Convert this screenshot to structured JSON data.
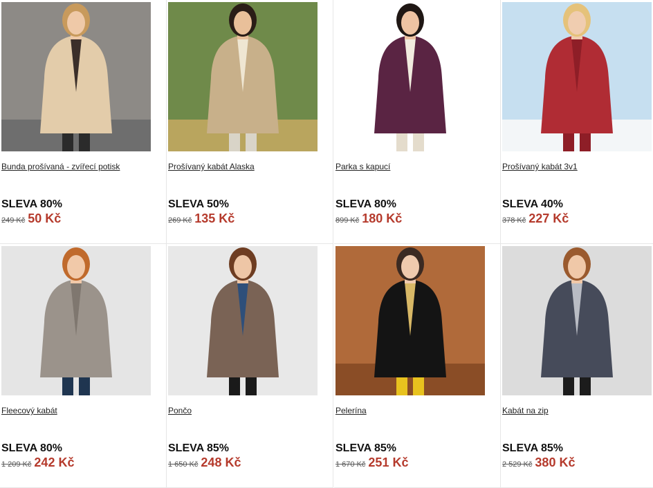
{
  "products": [
    {
      "name": "Bunda prošívaná - zvířecí potisk",
      "discount": "SLEVA 80%",
      "old_price": "249 Kč",
      "new_price": "50 Kč",
      "bg": "#8d8a86",
      "ground": "#6e6e6e",
      "garment": "#e3ccaa",
      "accent": "#3b2f2a",
      "hair": "#c89a5c",
      "skin": "#efc9a8",
      "legs": "#2b2b2b",
      "image": "woman-cream-quilted-jacket"
    },
    {
      "name": "Prošívaný kabát Alaska",
      "discount": "SLEVA 50%",
      "old_price": "269 Kč",
      "new_price": "135 Kč",
      "bg": "#6f8a4a",
      "ground": "#b9a55e",
      "garment": "#c8b08a",
      "accent": "#efe6d2",
      "hair": "#2a1d17",
      "skin": "#e9c09a",
      "legs": "#d9d4c8",
      "image": "woman-beige-quilted-coat"
    },
    {
      "name": "Parka s kapucí",
      "discount": "SLEVA 80%",
      "old_price": "899 Kč",
      "new_price": "180 Kč",
      "bg": "#ffffff",
      "ground": "#ffffff",
      "garment": "#5a2443",
      "accent": "#f1ebdf",
      "hair": "#1f1714",
      "skin": "#eec3a3",
      "legs": "#e4dccc",
      "image": "woman-purple-parka"
    },
    {
      "name": "Prošívaný kabát 3v1",
      "discount": "SLEVA 40%",
      "old_price": "378 Kč",
      "new_price": "227 Kč",
      "bg": "#c6dff0",
      "ground": "#f3f6f8",
      "garment": "#b02c34",
      "accent": "#8e1e27",
      "hair": "#e5c27a",
      "skin": "#f0cdb0",
      "legs": "#8e1e27",
      "image": "woman-red-winter-coat"
    },
    {
      "name": "Fleecový kabát",
      "discount": "SLEVA 80%",
      "old_price": "1 209 Kč",
      "new_price": "242 Kč",
      "bg": "#e5e5e5",
      "ground": "#e5e5e5",
      "garment": "#9b938b",
      "accent": "#7f776f",
      "hair": "#c06a2c",
      "skin": "#f1c9a9",
      "legs": "#1f3550",
      "image": "woman-grey-fleece-coat"
    },
    {
      "name": "Pončo",
      "discount": "SLEVA 85%",
      "old_price": "1 650 Kč",
      "new_price": "248 Kč",
      "bg": "#e8e8e8",
      "ground": "#e8e8e8",
      "garment": "#7a6355",
      "accent": "#2e4f7a",
      "hair": "#6e3d22",
      "skin": "#eec6a6",
      "legs": "#1a1a1a",
      "image": "woman-brown-poncho"
    },
    {
      "name": "Pelerína",
      "discount": "SLEVA 85%",
      "old_price": "1 670 Kč",
      "new_price": "251 Kč",
      "bg": "#b06a3a",
      "ground": "#8a4d26",
      "garment": "#141414",
      "accent": "#d8b866",
      "hair": "#3b2a22",
      "skin": "#efcaae",
      "legs": "#e8c21e",
      "image": "woman-black-cape-embroidered"
    },
    {
      "name": "Kabát na zip",
      "discount": "SLEVA 85%",
      "old_price": "2 529 Kč",
      "new_price": "380 Kč",
      "bg": "#dcdcdc",
      "ground": "#dcdcdc",
      "garment": "#464b5a",
      "accent": "#b9bcc4",
      "hair": "#9a5a2e",
      "skin": "#f0c8a8",
      "legs": "#1c1c1c",
      "image": "woman-grey-zip-coat"
    }
  ]
}
